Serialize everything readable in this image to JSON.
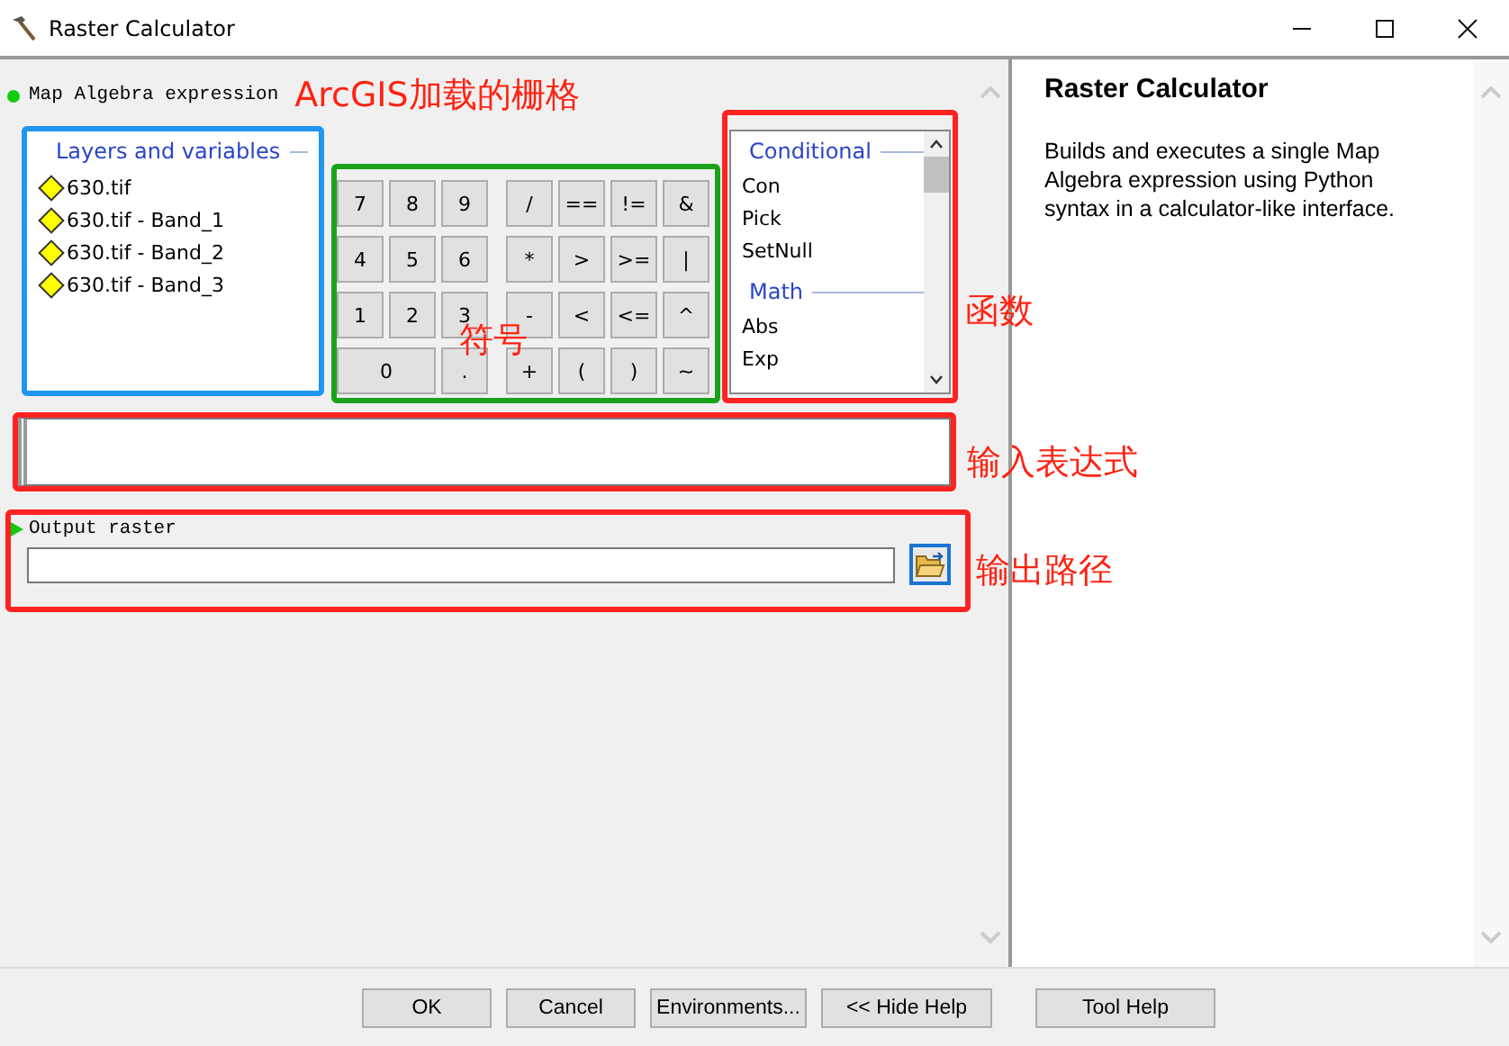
{
  "window": {
    "title": "Raster Calculator"
  },
  "expression": {
    "label": "Map Algebra expression"
  },
  "layers": {
    "title": "Layers and variables",
    "items": [
      "630.tif",
      "630.tif - Band_1",
      "630.tif - Band_2",
      "630.tif - Band_3"
    ]
  },
  "keypad": [
    [
      {
        "label": "7"
      },
      {
        "label": "8"
      },
      {
        "label": "9"
      },
      {
        "label": "/"
      },
      {
        "label": "=="
      },
      {
        "label": "!="
      },
      {
        "label": "&"
      }
    ],
    [
      {
        "label": "4"
      },
      {
        "label": "5"
      },
      {
        "label": "6"
      },
      {
        "label": "*"
      },
      {
        "label": ">"
      },
      {
        "label": ">="
      },
      {
        "label": "|"
      }
    ],
    [
      {
        "label": "1"
      },
      {
        "label": "2"
      },
      {
        "label": "3"
      },
      {
        "label": "-"
      },
      {
        "label": "<"
      },
      {
        "label": "<="
      },
      {
        "label": "^"
      }
    ],
    [
      {
        "label": "0",
        "wide": true
      },
      {
        "label": "."
      },
      {
        "label": "+"
      },
      {
        "label": "("
      },
      {
        "label": ")"
      },
      {
        "label": "~"
      }
    ]
  ],
  "functions": [
    {
      "group": "Conditional",
      "items": [
        "Con",
        "Pick",
        "SetNull"
      ]
    },
    {
      "group": "Math",
      "items": [
        "Abs",
        "Exp"
      ]
    }
  ],
  "output": {
    "label": "Output raster"
  },
  "help": {
    "title": "Raster Calculator",
    "text": "Builds and executes a single Map Algebra expression using Python syntax in a calculator-like interface."
  },
  "buttons": [
    "OK",
    "Cancel",
    "Environments...",
    "<< Hide Help",
    "Tool Help"
  ],
  "annotations": {
    "layers": "ArcGIS加载的栅格",
    "symbols": "符号",
    "functions": "函数",
    "expression": "输入表达式",
    "output": "输出路径"
  }
}
